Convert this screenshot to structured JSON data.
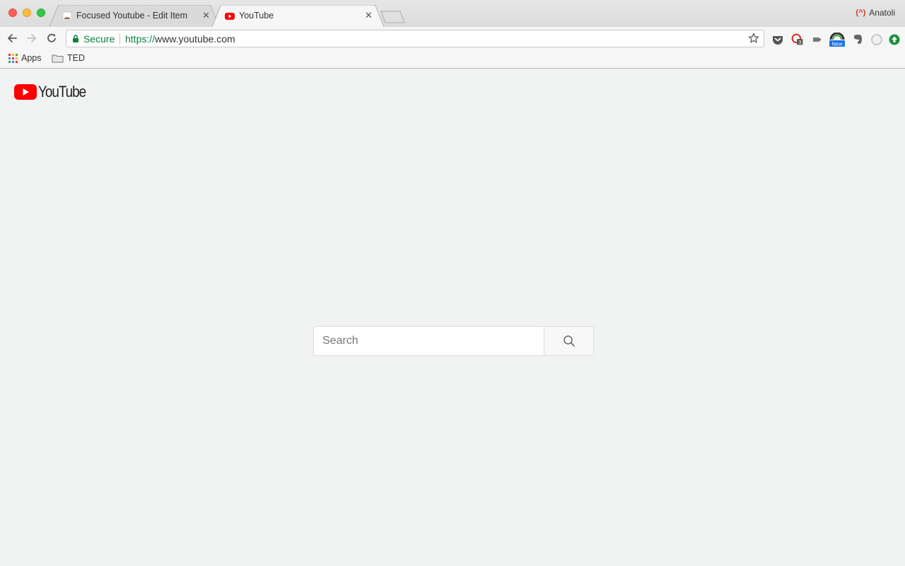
{
  "browser": {
    "tabs": [
      {
        "title": "Focused Youtube - Edit Item",
        "favicon": "rainbow-favicon-icon",
        "active": false
      },
      {
        "title": "YouTube",
        "favicon": "youtube-favicon-icon",
        "active": true
      }
    ],
    "close_glyph": "✕",
    "profile_name": "Anatoli",
    "omnibox": {
      "security_label": "Secure",
      "url_scheme": "https://",
      "url_host": "www.youtube.com"
    },
    "extension_badges": {
      "badge_count": "3",
      "badge_new": "New"
    },
    "bookmarks": [
      {
        "label": "Apps",
        "icon": "apps-grid-icon"
      },
      {
        "label": "TED",
        "icon": "folder-icon"
      }
    ]
  },
  "page": {
    "logo_text": "YouTube",
    "search": {
      "placeholder": "Search",
      "value": ""
    }
  },
  "colors": {
    "youtube_red": "#ff0000",
    "secure_green": "#0b8043",
    "page_background": "#f1f3f2"
  }
}
